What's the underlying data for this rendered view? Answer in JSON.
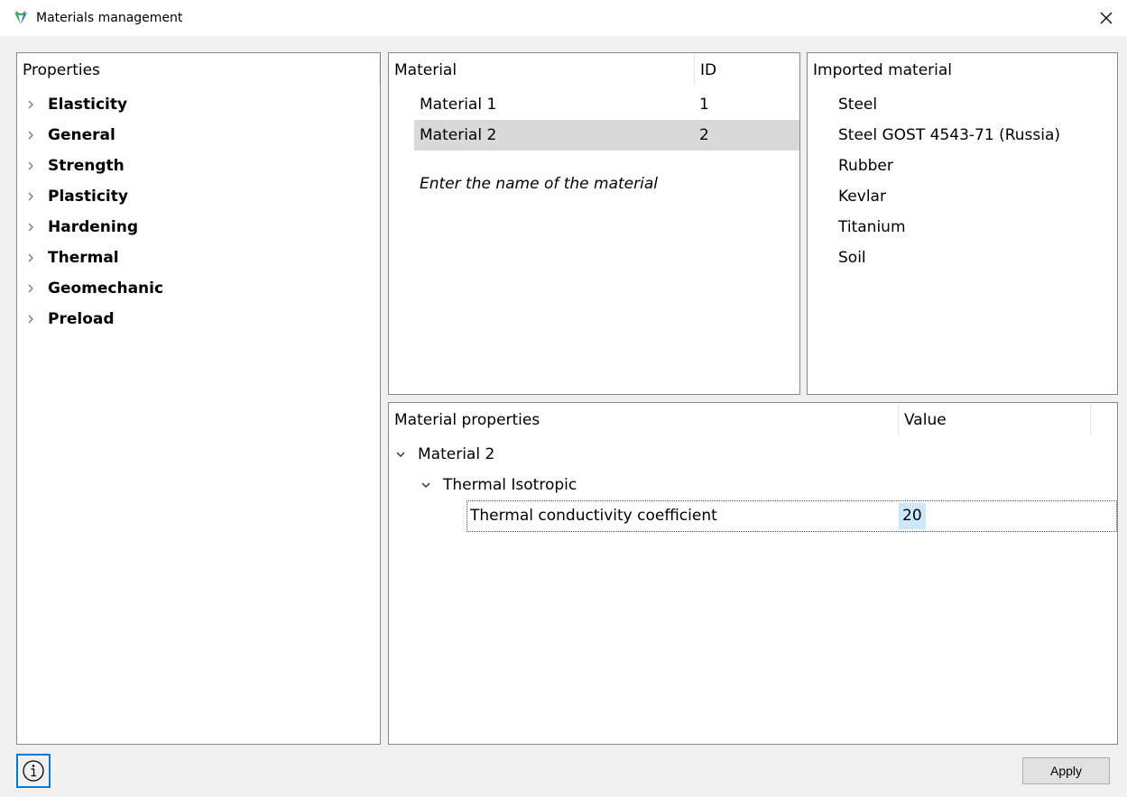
{
  "window": {
    "title": "Materials management"
  },
  "properties": {
    "header": "Properties",
    "items": [
      {
        "label": "Elasticity"
      },
      {
        "label": "General"
      },
      {
        "label": "Strength"
      },
      {
        "label": "Plasticity"
      },
      {
        "label": "Hardening"
      },
      {
        "label": "Thermal"
      },
      {
        "label": "Geomechanic"
      },
      {
        "label": "Preload"
      }
    ]
  },
  "materials": {
    "columns": [
      "Material",
      "ID"
    ],
    "rows": [
      {
        "name": "Material 1",
        "id": "1",
        "selected": false
      },
      {
        "name": "Material 2",
        "id": "2",
        "selected": true
      }
    ],
    "placeholder": "Enter the name of the material"
  },
  "imported": {
    "header": "Imported material",
    "items": [
      "Steel",
      "Steel GOST 4543-71 (Russia)",
      "Rubber",
      "Kevlar",
      "Titanium",
      "Soil"
    ]
  },
  "material_properties": {
    "columns": [
      "Material properties",
      "Value"
    ],
    "material": "Material 2",
    "group": "Thermal Isotropic",
    "property": {
      "name": "Thermal conductivity coefficient",
      "value": "20"
    }
  },
  "footer": {
    "apply_label": "Apply"
  },
  "colors": {
    "selection": "#d9d9d9",
    "value_highlight": "#cce8ff",
    "focus_border": "#0078d7",
    "app_icon_green": "#3aa35b",
    "app_icon_blue": "#2a6fb7"
  }
}
